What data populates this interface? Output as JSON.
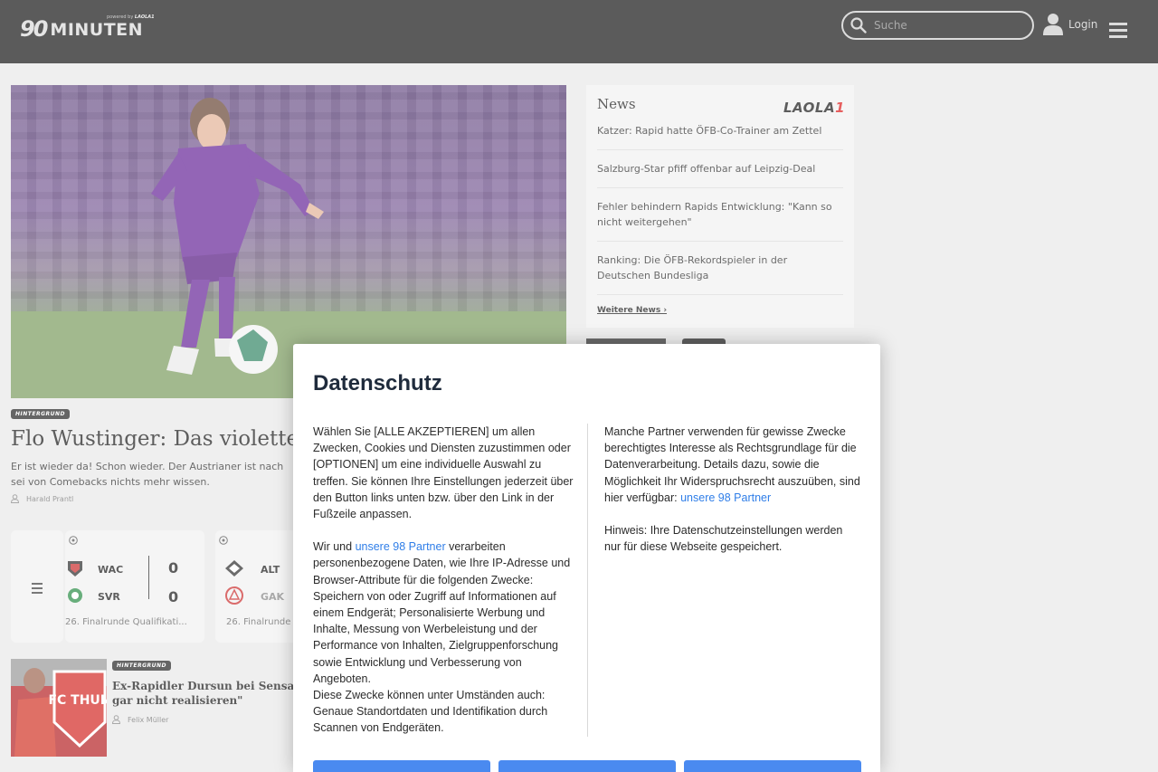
{
  "header": {
    "logo_mark": "90",
    "logo_text": "MINUTEN",
    "logo_sub_prefix": "powered by",
    "logo_sub_brand": "LAOLA1",
    "search_placeholder": "Suche",
    "login_label": "Login"
  },
  "main_article": {
    "tag": "HINTERGRUND",
    "headline": "Flo Wustinger: Das violette",
    "teaser": "Er ist wieder da! Schon wieder. Der Austrianer ist nach sei von Comebacks nichts mehr wissen.",
    "author": "Harald Prantl"
  },
  "matches": [
    {
      "home": "WAC",
      "away": "SVR",
      "home_score": "0",
      "away_score": "0",
      "round": "26. Finalrunde Qualifikati..."
    },
    {
      "home": "ALT",
      "away": "GAK",
      "round": "26. Finalrunde"
    }
  ],
  "small_article": {
    "tag": "HINTERGRUND",
    "headline_line1": "Ex-Rapidler Dursun bei Sensation",
    "headline_line2": "gar nicht realisieren\"",
    "author": "Felix Müller",
    "image_text": "FC THUN"
  },
  "news": {
    "title": "News",
    "brand": "LAOLA",
    "brand_suffix": "1",
    "items": [
      "Katzer: Rapid hatte ÖFB-Co-Trainer am Zettel",
      "Salzburg-Star pfiff offenbar auf Leipzig-Deal",
      "Fehler behindern Rapids Entwicklung: \"Kann so nicht weitergehen\"",
      "Ranking: Die ÖFB-Rekordspieler in der Deutschen Bundesliga"
    ],
    "more_label": "Weitere News ›"
  },
  "consent": {
    "title": "Datenschutz",
    "left_p1": "Wählen Sie [ALLE AKZEPTIEREN] um allen Zwecken, Cookies und Diensten zuzustimmen oder [OPTIONEN] um eine individuelle Auswahl zu treffen. Sie können Ihre Einstellungen jederzeit über den Button links unten bzw. über den Link in der Fußzeile anpassen.",
    "left_p2_prefix": "Wir und",
    "partners_link": "unsere 98 Partner",
    "left_p2_suffix": "verarbeiten personenbezogene Daten, wie Ihre IP-Adresse und Browser-Attribute für die folgenden Zwecke: Speichern von oder Zugriff auf Informationen auf einem Endgerät; Personalisierte Werbung und Inhalte, Messung von Werbeleistung und der Performance von Inhalten, Zielgruppenforschung sowie Entwicklung und Verbesserung von Angeboten.",
    "left_p3": "Diese Zwecke können unter Umständen auch: Genaue Standortdaten und Identifikation durch Scannen von Endgeräten.",
    "right_p1_prefix": "Manche Partner verwenden für gewisse Zwecke berechtigtes Interesse als Rechtsgrundlage für die Datenverarbeitung. Details dazu, sowie die Möglichkeit Ihr Widerspruchsrecht auszuüben, sind hier verfügbar:",
    "right_p2": "Hinweis: Ihre Datenschutzeinstellungen werden nur für diese Webseite gespeichert."
  },
  "colors": {
    "header_bg": "#1c1c1c",
    "link": "#2f7ee8",
    "button": "#4a8af0",
    "modal_title": "#1f2b3c"
  }
}
